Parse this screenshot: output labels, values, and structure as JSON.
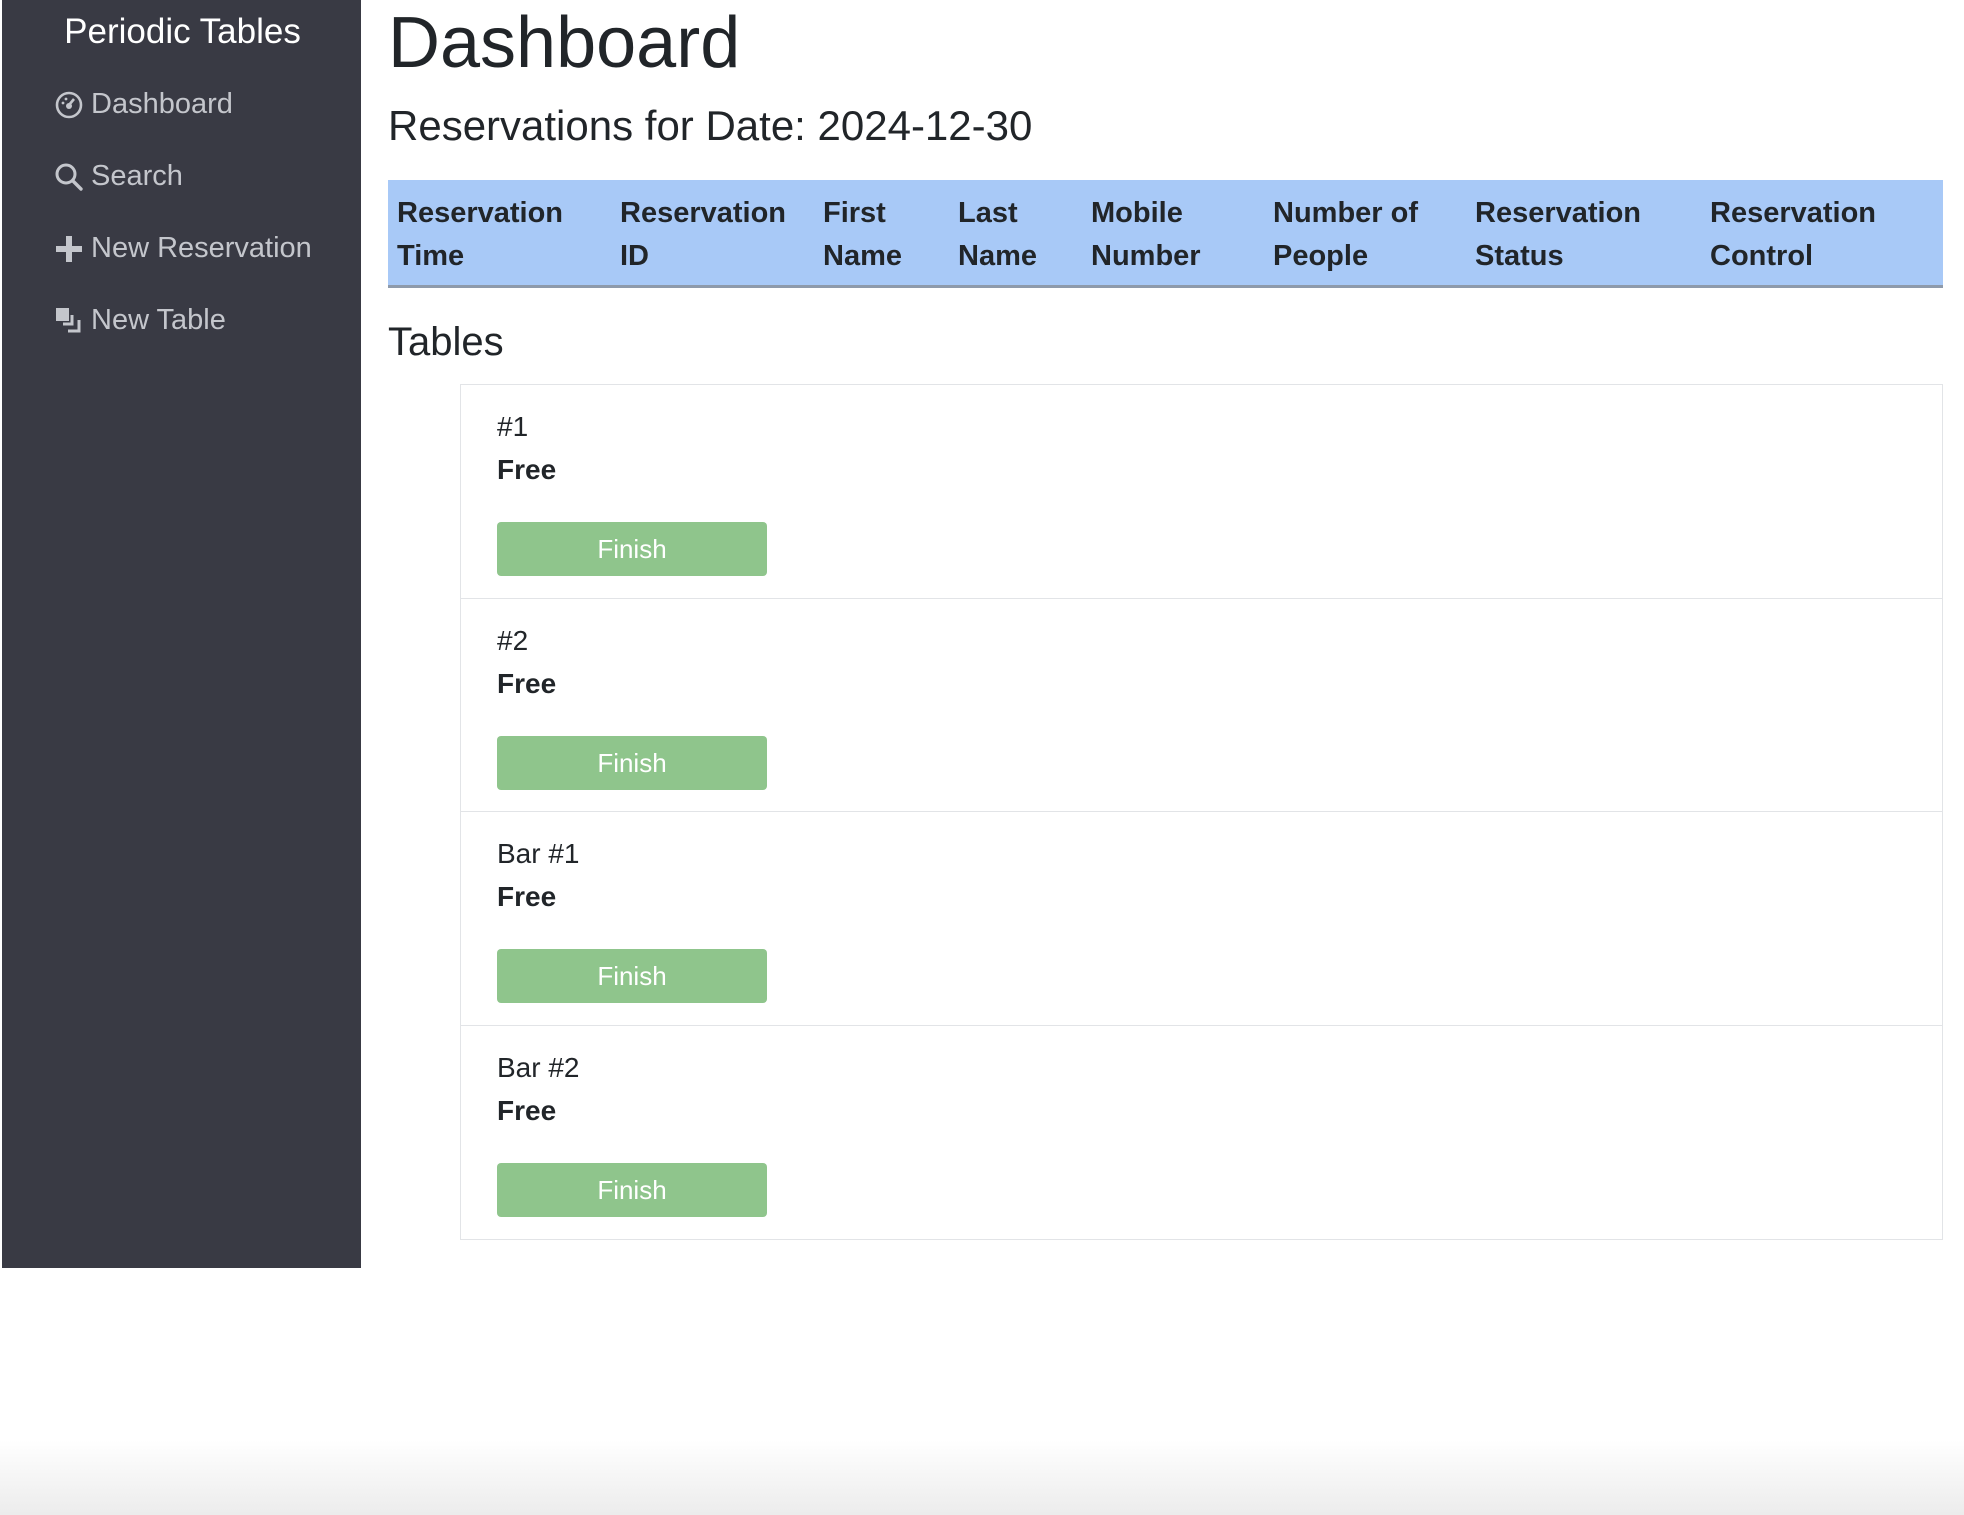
{
  "sidebar": {
    "brand": "Periodic Tables",
    "items": [
      {
        "label": "Dashboard",
        "icon": "dashboard-icon"
      },
      {
        "label": "Search",
        "icon": "search-icon"
      },
      {
        "label": "New Reservation",
        "icon": "plus-icon"
      },
      {
        "label": "New Table",
        "icon": "layers-icon"
      }
    ]
  },
  "main": {
    "title": "Dashboard",
    "reservations_heading": "Reservations for Date: 2024-12-30",
    "columns": [
      {
        "line1": "Reservation",
        "line2": "Time"
      },
      {
        "line1": "Reservation",
        "line2": "ID"
      },
      {
        "line1": "First",
        "line2": "Name"
      },
      {
        "line1": "Last",
        "line2": "Name"
      },
      {
        "line1": "Mobile",
        "line2": "Number"
      },
      {
        "line1": "Number of",
        "line2": "People"
      },
      {
        "line1": "Reservation",
        "line2": "Status"
      },
      {
        "line1": "Reservation",
        "line2": "Control"
      }
    ],
    "tables_heading": "Tables",
    "tables": [
      {
        "name": "#1",
        "status": "Free",
        "button": "Finish"
      },
      {
        "name": "#2",
        "status": "Free",
        "button": "Finish"
      },
      {
        "name": "Bar #1",
        "status": "Free",
        "button": "Finish"
      },
      {
        "name": "Bar #2",
        "status": "Free",
        "button": "Finish"
      }
    ]
  },
  "colors": {
    "sidebar_bg": "#393a44",
    "table_header_bg": "#a8c9f7",
    "finish_button": "#8fc58c"
  }
}
